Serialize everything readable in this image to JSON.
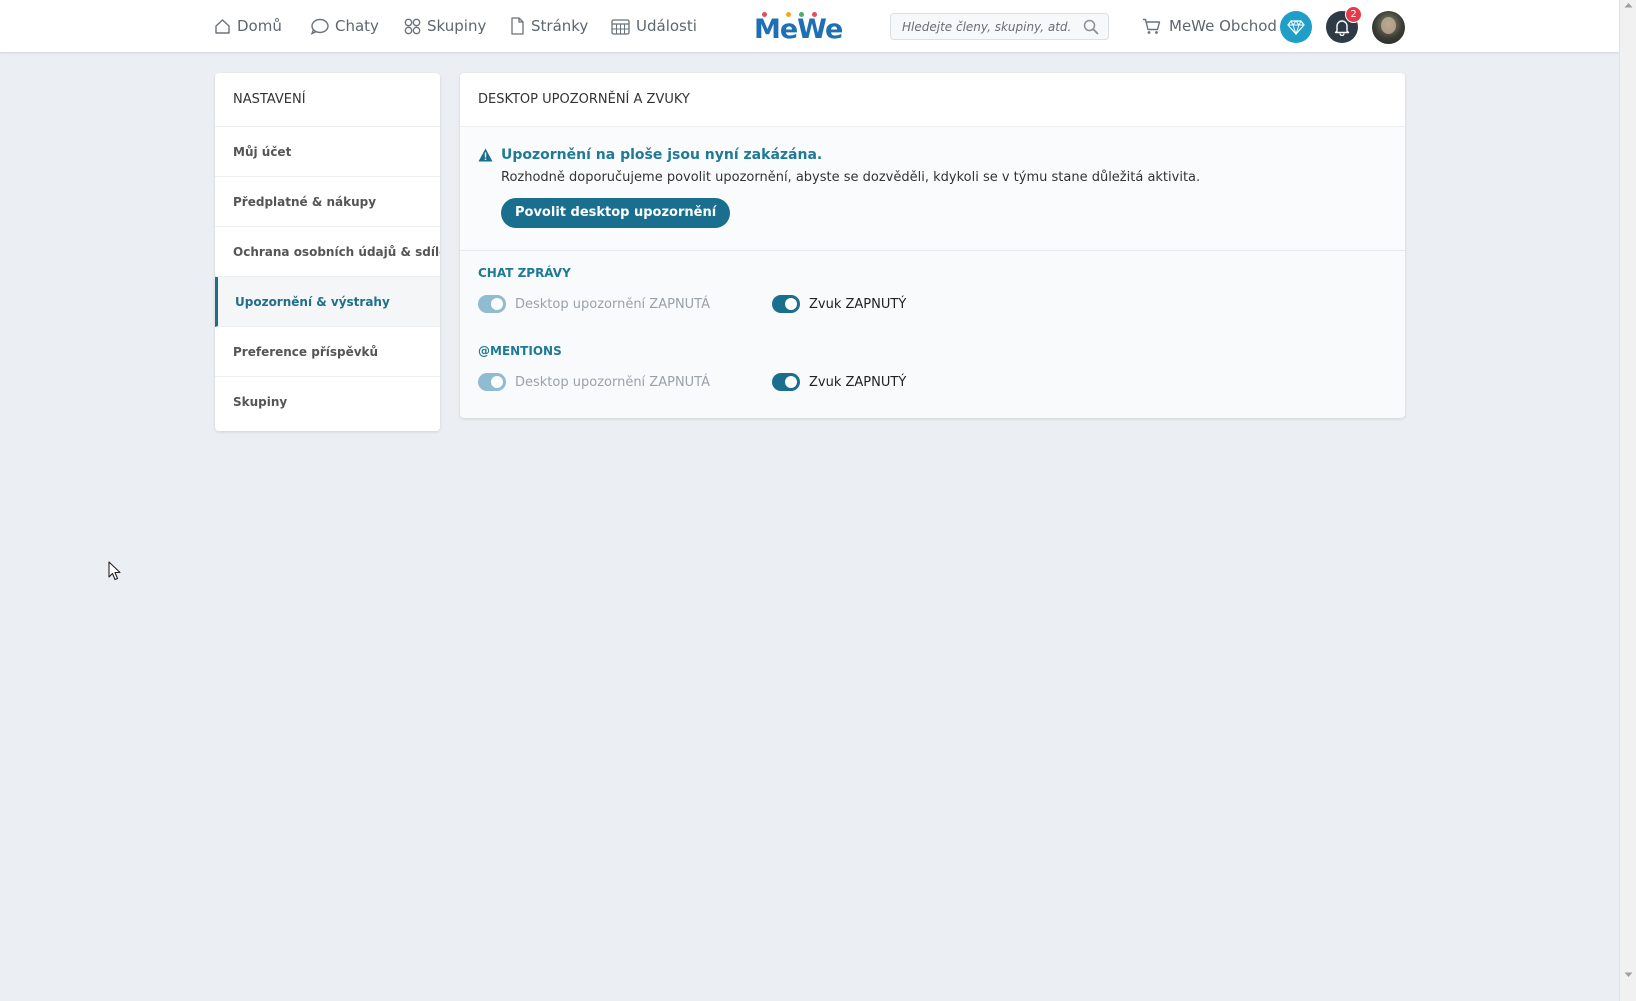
{
  "nav": {
    "items": [
      {
        "label": "Domů",
        "icon": "home-icon"
      },
      {
        "label": "Chaty",
        "icon": "chat-bubble-icon"
      },
      {
        "label": "Skupiny",
        "icon": "groups-icon"
      },
      {
        "label": "Stránky",
        "icon": "page-icon"
      },
      {
        "label": "Události",
        "icon": "calendar-icon"
      }
    ],
    "logo": "MeWe",
    "search_placeholder": "Hledejte členy, skupiny, atd.",
    "shop_label": "MeWe Obchod",
    "notification_count": "2"
  },
  "sidebar": {
    "title": "NASTAVENÍ",
    "items": [
      {
        "label": "Můj účet"
      },
      {
        "label": "Předplatné & nákupy"
      },
      {
        "label": "Ochrana osobních údajů & sdílení"
      },
      {
        "label": "Upozornění & výstrahy",
        "active": true
      },
      {
        "label": "Preference příspěvků"
      },
      {
        "label": "Skupiny"
      }
    ]
  },
  "main": {
    "title": "DESKTOP UPOZORNĚNÍ A ZVUKY",
    "alert": {
      "title": "Upozornění na ploše jsou nyní zakázána.",
      "text": "Rozhodně doporučujeme povolit upozornění, abyste se dozvěděli, kdykoli se v týmu stane důležitá aktivita.",
      "button": "Povolit desktop upozornění"
    },
    "sections": [
      {
        "heading": "CHAT ZPRÁVY",
        "desktop_label": "Desktop upozornění ZAPNUTÁ",
        "sound_label": "Zvuk ZAPNUTÝ"
      },
      {
        "heading": "@MENTIONS",
        "desktop_label": "Desktop upozornění ZAPNUTÁ",
        "sound_label": "Zvuk ZAPNUTÝ"
      }
    ]
  },
  "colors": {
    "accent": "#1a6e8e",
    "heading": "#1f7a96",
    "background": "#ebeff3",
    "badge": "#e63a4b"
  }
}
